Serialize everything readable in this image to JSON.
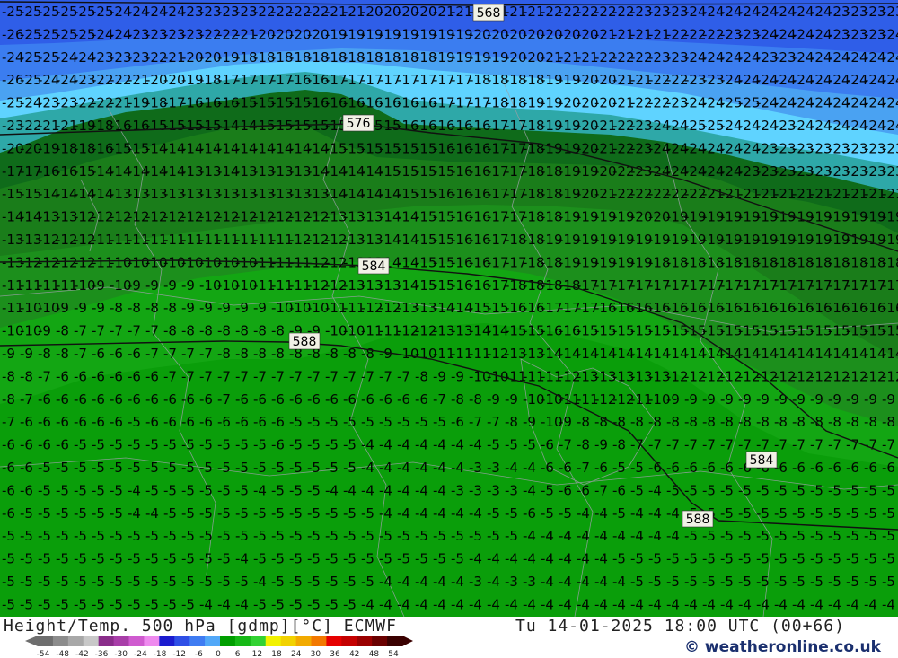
{
  "map": {
    "row_values": [
      [
        "25",
        "25",
        "25",
        "25",
        "25",
        "25",
        "24",
        "24",
        "24",
        "24",
        "23",
        "23",
        "23",
        "23",
        "22",
        "22",
        "22",
        "22",
        "21",
        "21",
        "20",
        "20",
        "20",
        "20",
        "21",
        "21",
        "21",
        "21",
        "21",
        "21",
        "22",
        "22",
        "22",
        "22",
        "22",
        "23",
        "23",
        "23",
        "24",
        "24",
        "24",
        "24",
        "24",
        "24",
        "24",
        "24",
        "23",
        "23",
        "23",
        "23"
      ],
      [
        "26",
        "25",
        "25",
        "25",
        "25",
        "24",
        "24",
        "23",
        "23",
        "23",
        "23",
        "22",
        "22",
        "21",
        "20",
        "20",
        "20",
        "20",
        "19",
        "19",
        "19",
        "19",
        "19",
        "19",
        "19",
        "19",
        "20",
        "20",
        "20",
        "20",
        "20",
        "20",
        "20",
        "21",
        "21",
        "21",
        "21",
        "22",
        "22",
        "22",
        "23",
        "23",
        "24",
        "24",
        "24",
        "24",
        "23",
        "23",
        "23",
        "24"
      ],
      [
        "24",
        "25",
        "25",
        "24",
        "24",
        "23",
        "23",
        "23",
        "22",
        "21",
        "20",
        "20",
        "19",
        "18",
        "18",
        "18",
        "18",
        "18",
        "18",
        "18",
        "18",
        "18",
        "18",
        "18",
        "19",
        "19",
        "19",
        "19",
        "20",
        "20",
        "21",
        "21",
        "21",
        "22",
        "22",
        "22",
        "23",
        "23",
        "24",
        "24",
        "24",
        "24",
        "23",
        "23",
        "24",
        "24",
        "24",
        "24",
        "24",
        "24"
      ],
      [
        "26",
        "25",
        "24",
        "24",
        "23",
        "22",
        "22",
        "21",
        "20",
        "20",
        "19",
        "18",
        "17",
        "17",
        "17",
        "17",
        "16",
        "16",
        "17",
        "17",
        "17",
        "17",
        "17",
        "17",
        "17",
        "17",
        "18",
        "18",
        "18",
        "18",
        "19",
        "19",
        "20",
        "20",
        "21",
        "21",
        "22",
        "22",
        "23",
        "23",
        "24",
        "24",
        "24",
        "24",
        "24",
        "24",
        "24",
        "24",
        "24",
        "24"
      ],
      [
        "25",
        "24",
        "23",
        "23",
        "22",
        "22",
        "21",
        "19",
        "18",
        "17",
        "16",
        "16",
        "16",
        "15",
        "15",
        "15",
        "15",
        "16",
        "16",
        "16",
        "16",
        "16",
        "16",
        "16",
        "17",
        "17",
        "17",
        "18",
        "18",
        "19",
        "19",
        "20",
        "20",
        "20",
        "21",
        "22",
        "22",
        "23",
        "24",
        "24",
        "25",
        "25",
        "24",
        "24",
        "24",
        "24",
        "24",
        "24",
        "24",
        "24"
      ],
      [
        "23",
        "22",
        "21",
        "21",
        "19",
        "18",
        "16",
        "16",
        "15",
        "15",
        "15",
        "15",
        "14",
        "14",
        "15",
        "15",
        "15",
        "15",
        "15",
        "15",
        "15",
        "15",
        "16",
        "16",
        "16",
        "16",
        "16",
        "17",
        "17",
        "18",
        "19",
        "19",
        "20",
        "21",
        "22",
        "23",
        "24",
        "24",
        "25",
        "25",
        "24",
        "24",
        "24",
        "23",
        "24",
        "24",
        "24",
        "24",
        "24",
        "24"
      ],
      [
        "20",
        "20",
        "19",
        "18",
        "18",
        "16",
        "15",
        "15",
        "14",
        "14",
        "14",
        "14",
        "14",
        "14",
        "14",
        "14",
        "14",
        "14",
        "15",
        "15",
        "15",
        "15",
        "15",
        "15",
        "16",
        "16",
        "16",
        "17",
        "17",
        "18",
        "19",
        "19",
        "20",
        "21",
        "22",
        "23",
        "24",
        "24",
        "24",
        "24",
        "24",
        "24",
        "23",
        "23",
        "23",
        "23",
        "23",
        "23",
        "23",
        "23"
      ],
      [
        "17",
        "17",
        "16",
        "16",
        "15",
        "14",
        "14",
        "14",
        "14",
        "14",
        "13",
        "13",
        "14",
        "13",
        "13",
        "13",
        "13",
        "14",
        "14",
        "14",
        "14",
        "15",
        "15",
        "15",
        "15",
        "16",
        "16",
        "17",
        "17",
        "18",
        "18",
        "19",
        "19",
        "20",
        "22",
        "23",
        "24",
        "24",
        "24",
        "24",
        "24",
        "23",
        "23",
        "23",
        "23",
        "23",
        "23",
        "23",
        "23",
        "23"
      ],
      [
        "15",
        "15",
        "14",
        "14",
        "14",
        "14",
        "13",
        "13",
        "13",
        "13",
        "13",
        "13",
        "13",
        "13",
        "13",
        "13",
        "13",
        "13",
        "14",
        "14",
        "14",
        "14",
        "15",
        "15",
        "16",
        "16",
        "16",
        "17",
        "17",
        "18",
        "18",
        "19",
        "20",
        "21",
        "22",
        "22",
        "22",
        "22",
        "22",
        "21",
        "21",
        "21",
        "21",
        "21",
        "21",
        "21",
        "21",
        "21",
        "21",
        "21"
      ],
      [
        "14",
        "14",
        "13",
        "13",
        "12",
        "12",
        "12",
        "12",
        "12",
        "12",
        "12",
        "12",
        "12",
        "12",
        "12",
        "12",
        "12",
        "12",
        "13",
        "13",
        "13",
        "14",
        "14",
        "15",
        "15",
        "16",
        "16",
        "17",
        "17",
        "18",
        "18",
        "19",
        "19",
        "19",
        "19",
        "20",
        "20",
        "19",
        "19",
        "19",
        "19",
        "19",
        "19",
        "19",
        "19",
        "19",
        "19",
        "19",
        "19",
        "19"
      ],
      [
        "13",
        "13",
        "12",
        "12",
        "12",
        "11",
        "11",
        "11",
        "11",
        "11",
        "11",
        "11",
        "11",
        "11",
        "11",
        "11",
        "12",
        "12",
        "12",
        "13",
        "13",
        "14",
        "14",
        "15",
        "15",
        "16",
        "16",
        "17",
        "18",
        "18",
        "19",
        "19",
        "19",
        "19",
        "19",
        "19",
        "19",
        "19",
        "19",
        "19",
        "19",
        "19",
        "19",
        "19",
        "19",
        "19",
        "19",
        "19",
        "19",
        "19"
      ],
      [
        "13",
        "12",
        "12",
        "12",
        "12",
        "11",
        "10",
        "10",
        "10",
        "10",
        "10",
        "10",
        "10",
        "10",
        "11",
        "11",
        "11",
        "12",
        "12",
        "13",
        "13",
        "14",
        "14",
        "15",
        "15",
        "16",
        "16",
        "17",
        "17",
        "18",
        "18",
        "19",
        "19",
        "19",
        "19",
        "19",
        "18",
        "18",
        "18",
        "18",
        "18",
        "18",
        "18",
        "18",
        "18",
        "18",
        "18",
        "18",
        "18",
        "18"
      ],
      [
        "11",
        "11",
        "11",
        "11",
        "10",
        "9",
        "10",
        "9",
        "9",
        "9",
        "9",
        "10",
        "10",
        "10",
        "11",
        "11",
        "11",
        "12",
        "12",
        "13",
        "13",
        "13",
        "14",
        "15",
        "15",
        "16",
        "16",
        "17",
        "18",
        "18",
        "18",
        "18",
        "17",
        "17",
        "17",
        "17",
        "17",
        "17",
        "17",
        "17",
        "17",
        "17",
        "17",
        "17",
        "17",
        "17",
        "17",
        "17",
        "17",
        "17"
      ],
      [
        "11",
        "10",
        "10",
        "9",
        "9",
        "9",
        "8",
        "8",
        "8",
        "8",
        "9",
        "9",
        "9",
        "9",
        "9",
        "10",
        "10",
        "10",
        "11",
        "11",
        "12",
        "12",
        "13",
        "13",
        "14",
        "14",
        "15",
        "15",
        "16",
        "16",
        "17",
        "17",
        "17",
        "16",
        "16",
        "16",
        "16",
        "16",
        "16",
        "16",
        "16",
        "16",
        "16",
        "16",
        "16",
        "16",
        "16",
        "16",
        "16",
        "16"
      ],
      [
        "10",
        "10",
        "9",
        "8",
        "7",
        "7",
        "7",
        "7",
        "7",
        "8",
        "8",
        "8",
        "8",
        "8",
        "8",
        "8",
        "9",
        "9",
        "10",
        "10",
        "11",
        "11",
        "12",
        "12",
        "13",
        "13",
        "14",
        "14",
        "15",
        "15",
        "16",
        "16",
        "15",
        "15",
        "15",
        "15",
        "15",
        "15",
        "15",
        "15",
        "15",
        "15",
        "15",
        "15",
        "15",
        "15",
        "15",
        "15",
        "15",
        "15"
      ],
      [
        "9",
        "9",
        "8",
        "8",
        "7",
        "6",
        "6",
        "6",
        "7",
        "7",
        "7",
        "7",
        "8",
        "8",
        "8",
        "8",
        "8",
        "8",
        "8",
        "8",
        "8",
        "9",
        "10",
        "10",
        "11",
        "11",
        "11",
        "12",
        "13",
        "13",
        "14",
        "14",
        "14",
        "14",
        "14",
        "14",
        "14",
        "14",
        "14",
        "14",
        "14",
        "14",
        "14",
        "14",
        "14",
        "14",
        "14",
        "14",
        "14",
        "14"
      ],
      [
        "8",
        "8",
        "7",
        "6",
        "6",
        "6",
        "6",
        "6",
        "6",
        "7",
        "7",
        "7",
        "7",
        "7",
        "7",
        "7",
        "7",
        "7",
        "7",
        "7",
        "7",
        "7",
        "7",
        "8",
        "9",
        "9",
        "10",
        "10",
        "11",
        "11",
        "11",
        "12",
        "13",
        "13",
        "13",
        "13",
        "13",
        "12",
        "12",
        "12",
        "12",
        "12",
        "12",
        "12",
        "12",
        "12",
        "12",
        "12",
        "12",
        "12"
      ],
      [
        "8",
        "7",
        "6",
        "6",
        "6",
        "6",
        "6",
        "6",
        "6",
        "6",
        "6",
        "6",
        "7",
        "6",
        "6",
        "6",
        "6",
        "6",
        "6",
        "6",
        "6",
        "6",
        "6",
        "6",
        "7",
        "8",
        "8",
        "9",
        "9",
        "10",
        "10",
        "11",
        "11",
        "12",
        "12",
        "11",
        "10",
        "9",
        "9",
        "9",
        "9",
        "9",
        "9",
        "9",
        "9",
        "9",
        "9",
        "9",
        "9",
        "9"
      ],
      [
        "7",
        "6",
        "6",
        "6",
        "6",
        "6",
        "6",
        "5",
        "6",
        "6",
        "6",
        "6",
        "6",
        "6",
        "6",
        "6",
        "5",
        "5",
        "5",
        "5",
        "5",
        "5",
        "5",
        "5",
        "5",
        "6",
        "7",
        "7",
        "8",
        "9",
        "10",
        "9",
        "8",
        "8",
        "8",
        "8",
        "8",
        "8",
        "8",
        "8",
        "8",
        "8",
        "8",
        "8",
        "8",
        "8",
        "8",
        "8",
        "8",
        "8"
      ],
      [
        "6",
        "6",
        "6",
        "6",
        "5",
        "5",
        "5",
        "5",
        "5",
        "5",
        "5",
        "5",
        "5",
        "5",
        "5",
        "6",
        "5",
        "5",
        "5",
        "5",
        "4",
        "4",
        "4",
        "4",
        "4",
        "4",
        "4",
        "5",
        "5",
        "5",
        "6",
        "7",
        "8",
        "9",
        "8",
        "7",
        "7",
        "7",
        "7",
        "7",
        "7",
        "7",
        "7",
        "7",
        "7",
        "7",
        "7",
        "7",
        "7",
        "7"
      ],
      [
        "6",
        "6",
        "5",
        "5",
        "5",
        "5",
        "5",
        "5",
        "5",
        "5",
        "5",
        "5",
        "5",
        "5",
        "5",
        "5",
        "5",
        "5",
        "5",
        "5",
        "4",
        "4",
        "4",
        "4",
        "4",
        "4",
        "3",
        "3",
        "4",
        "4",
        "6",
        "6",
        "7",
        "6",
        "5",
        "5",
        "6",
        "6",
        "6",
        "6",
        "6",
        "6",
        "6",
        "6",
        "6",
        "6",
        "6",
        "6",
        "6",
        "6"
      ],
      [
        "6",
        "6",
        "5",
        "5",
        "5",
        "5",
        "5",
        "4",
        "5",
        "5",
        "5",
        "5",
        "5",
        "5",
        "4",
        "5",
        "5",
        "5",
        "4",
        "4",
        "4",
        "4",
        "4",
        "4",
        "4",
        "3",
        "3",
        "3",
        "3",
        "4",
        "5",
        "6",
        "6",
        "7",
        "6",
        "5",
        "4",
        "5",
        "5",
        "5",
        "5",
        "5",
        "5",
        "5",
        "5",
        "5",
        "5",
        "5",
        "5",
        "5"
      ],
      [
        "6",
        "5",
        "5",
        "5",
        "5",
        "5",
        "5",
        "4",
        "4",
        "5",
        "5",
        "5",
        "5",
        "5",
        "5",
        "5",
        "5",
        "5",
        "5",
        "5",
        "5",
        "4",
        "4",
        "4",
        "4",
        "4",
        "4",
        "5",
        "5",
        "6",
        "5",
        "5",
        "4",
        "4",
        "5",
        "4",
        "4",
        "4",
        "5",
        "5",
        "5",
        "5",
        "5",
        "5",
        "5",
        "5",
        "5",
        "5",
        "5",
        "5"
      ],
      [
        "5",
        "5",
        "5",
        "5",
        "5",
        "5",
        "5",
        "5",
        "5",
        "5",
        "5",
        "5",
        "5",
        "5",
        "5",
        "5",
        "5",
        "5",
        "5",
        "5",
        "5",
        "5",
        "5",
        "5",
        "5",
        "5",
        "5",
        "5",
        "5",
        "4",
        "4",
        "4",
        "4",
        "4",
        "4",
        "4",
        "4",
        "4",
        "5",
        "5",
        "5",
        "5",
        "5",
        "5",
        "5",
        "5",
        "5",
        "5",
        "5",
        "5"
      ],
      [
        "5",
        "5",
        "5",
        "5",
        "5",
        "5",
        "5",
        "5",
        "5",
        "5",
        "5",
        "5",
        "5",
        "4",
        "5",
        "5",
        "5",
        "5",
        "5",
        "5",
        "5",
        "5",
        "5",
        "5",
        "5",
        "5",
        "4",
        "4",
        "4",
        "4",
        "4",
        "4",
        "4",
        "4",
        "5",
        "5",
        "5",
        "5",
        "5",
        "5",
        "5",
        "5",
        "5",
        "5",
        "5",
        "5",
        "5",
        "5",
        "5",
        "5"
      ],
      [
        "5",
        "5",
        "5",
        "5",
        "5",
        "5",
        "5",
        "5",
        "5",
        "5",
        "5",
        "5",
        "5",
        "5",
        "4",
        "5",
        "5",
        "5",
        "5",
        "5",
        "5",
        "4",
        "4",
        "4",
        "4",
        "4",
        "3",
        "4",
        "3",
        "3",
        "4",
        "4",
        "4",
        "4",
        "4",
        "5",
        "5",
        "5",
        "5",
        "5",
        "5",
        "5",
        "5",
        "5",
        "5",
        "5",
        "5",
        "5",
        "5",
        "5"
      ],
      [
        "5",
        "5",
        "5",
        "5",
        "5",
        "5",
        "5",
        "5",
        "5",
        "5",
        "5",
        "4",
        "4",
        "4",
        "5",
        "5",
        "5",
        "5",
        "5",
        "5",
        "4",
        "4",
        "4",
        "4",
        "4",
        "4",
        "4",
        "4",
        "4",
        "4",
        "4",
        "4",
        "4",
        "4",
        "4",
        "4",
        "4",
        "4",
        "4",
        "4",
        "4",
        "4",
        "4",
        "4",
        "4",
        "4",
        "4",
        "4",
        "4",
        "4"
      ]
    ],
    "contour_labels": [
      "568",
      "576",
      "584",
      "588",
      "584",
      "588"
    ]
  },
  "footer": {
    "title": "Height/Temp. 500 hPa [gdmp][°C] ECMWF",
    "valid_time": "Tu 14-01-2025 18:00 UTC (00+66)",
    "credit": "© weatheronline.co.uk",
    "scale_ticks": [
      "-54",
      "-48",
      "-42",
      "-36",
      "-30",
      "-24",
      "-18",
      "-12",
      "-6",
      "0",
      "6",
      "12",
      "18",
      "24",
      "30",
      "36",
      "42",
      "48",
      "54"
    ],
    "scale_colors": [
      "#6e6e6e",
      "#8c8c8c",
      "#a8a8a8",
      "#c8c8c8",
      "#8a2d8a",
      "#a83ea8",
      "#cf5bcf",
      "#ee8aee",
      "#1c1ccf",
      "#2f4fe6",
      "#3f7cf2",
      "#52a8f8",
      "#009e00",
      "#16b816",
      "#32d232",
      "#f2f200",
      "#f2d200",
      "#f2aa00",
      "#f27800",
      "#e60000",
      "#c40000",
      "#9a0000",
      "#6a0000",
      "#3a0000"
    ]
  }
}
